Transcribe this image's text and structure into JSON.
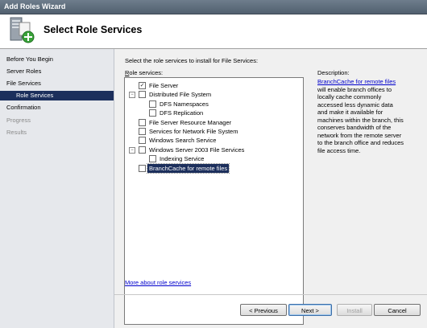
{
  "window": {
    "title": "Add Roles Wizard"
  },
  "header": {
    "title": "Select Role Services",
    "icon": "server-roles-icon"
  },
  "nav": {
    "items": [
      {
        "label": "Before You Begin",
        "state": "normal"
      },
      {
        "label": "Server Roles",
        "state": "normal"
      },
      {
        "label": "File Services",
        "state": "normal"
      },
      {
        "label": "Role Services",
        "state": "active"
      },
      {
        "label": "Confirmation",
        "state": "normal"
      },
      {
        "label": "Progress",
        "state": "disabled"
      },
      {
        "label": "Results",
        "state": "disabled"
      }
    ]
  },
  "main": {
    "instruction": "Select the role services to install for File Services:",
    "services_label_accel": "R",
    "services_label_rest": "ole services:",
    "services": [
      {
        "label": "File Server",
        "checked": true,
        "expander": ""
      },
      {
        "label": "Distributed File System",
        "checked": false,
        "expander": "−"
      },
      {
        "label": "DFS Namespaces",
        "checked": false,
        "expander": ""
      },
      {
        "label": "DFS Replication",
        "checked": false,
        "expander": ""
      },
      {
        "label": "File Server Resource Manager",
        "checked": false,
        "expander": ""
      },
      {
        "label": "Services for Network File System",
        "checked": false,
        "expander": ""
      },
      {
        "label": "Windows Search Service",
        "checked": false,
        "expander": ""
      },
      {
        "label": "Windows Server 2003 File Services",
        "checked": false,
        "expander": "−"
      },
      {
        "label": "Indexing Service",
        "checked": false,
        "expander": ""
      },
      {
        "label": "BranchCache for remote files",
        "checked": false,
        "expander": "",
        "selected": true
      }
    ],
    "more_link": "More about role services",
    "description_heading": "Description:",
    "description_link": "BranchCache for remote files",
    "description_text": " will enable branch offices to locally cache commonly accessed less dynamic data and make it available for machines within the branch, this conserves bandwidth of the network from the remote server to the branch office and reduces file access time."
  },
  "buttons": {
    "previous": "< Previous",
    "next": "Next >",
    "install": "Install",
    "cancel": "Cancel"
  },
  "colors": {
    "nav_active": "#1c2f5c",
    "link": "#0000cc"
  }
}
